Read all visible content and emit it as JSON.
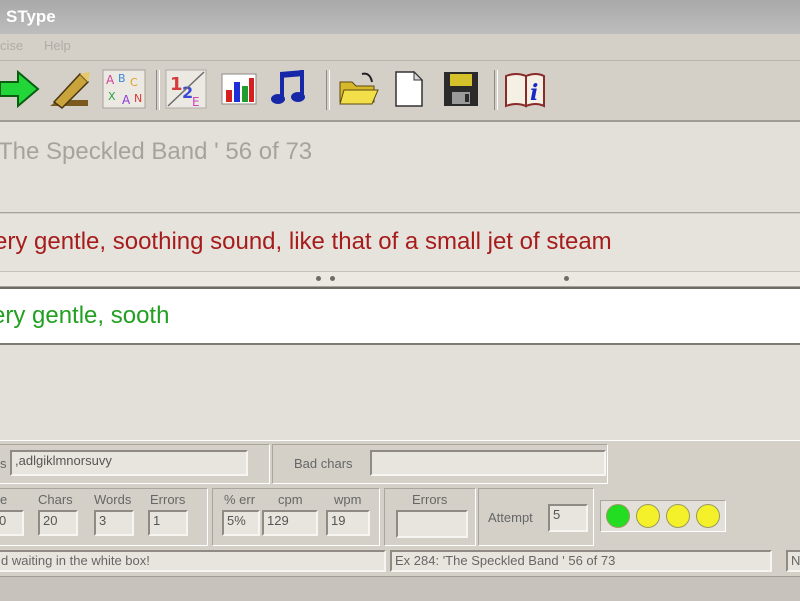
{
  "window": {
    "title": "SType"
  },
  "menu": [
    "cise",
    "Help"
  ],
  "toolbar": {
    "icons": [
      "arrow-right-icon",
      "pencil-icon",
      "alphabet-icon",
      "typing-icon",
      "bar-chart-icon",
      "music-note-icon",
      "open-folder-icon",
      "new-file-icon",
      "save-disk-icon",
      "help-book-icon"
    ],
    "colors": {
      "arrow": "#22d63a",
      "chart_red": "#d61f1f",
      "chart_blue": "#1f2fd6",
      "chart_green": "#1f9d2f",
      "music": "#1628a8",
      "folder": "#e8d23a"
    }
  },
  "exercise": {
    "title": "The Speckled Band ' 56 of 73"
  },
  "target_text": "ery gentle, soothing sound, like that of a small jet of steam",
  "typed_text": "ery gentle, sooth",
  "keys": {
    "label": "s",
    "value": ",adlgiklmnorsuvy",
    "bad_label": "Bad chars",
    "bad_value": ""
  },
  "stats": {
    "labels": [
      "e",
      "Chars",
      "Words",
      "Errors"
    ],
    "values": [
      "0",
      "20",
      "3",
      "1"
    ]
  },
  "rates": {
    "labels": [
      "% err",
      "cpm",
      "wpm"
    ],
    "values": [
      "5%",
      "129",
      "19"
    ]
  },
  "errors": {
    "label": "Errors",
    "value": ""
  },
  "attempt": {
    "label": "Attempt",
    "value": "5"
  },
  "lights": [
    {
      "state": "green",
      "color": "#22dd22"
    },
    {
      "state": "yellow",
      "color": "#f4f02a"
    },
    {
      "state": "yellow",
      "color": "#f4f02a"
    },
    {
      "state": "yellow",
      "color": "#f4f02a"
    }
  ],
  "statusbar": {
    "left": "d waiting in the white box!",
    "middle": "Ex 284: 'The Speckled Band ' 56 of 73",
    "right": "N"
  }
}
